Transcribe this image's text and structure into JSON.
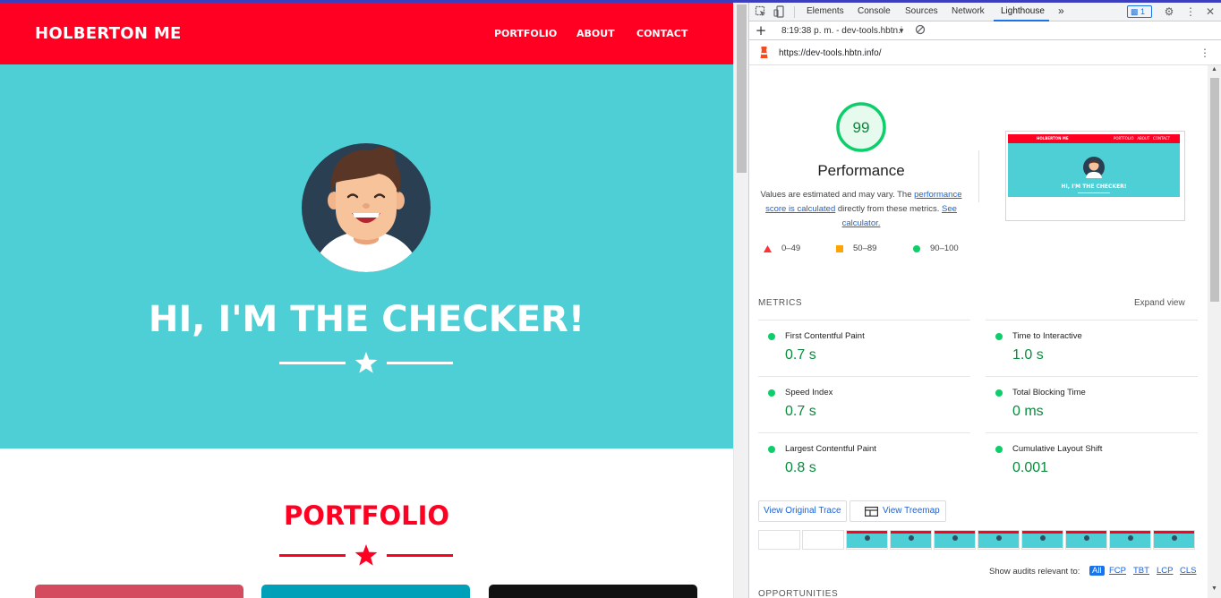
{
  "site": {
    "brand": "HOLBERTON ME",
    "nav": [
      "PORTFOLIO",
      "ABOUT",
      "CONTACT"
    ],
    "hero_title": "HI, I'M THE CHECKER!",
    "portfolio_title": "PORTFOLIO",
    "colors": {
      "red": "#ff0022",
      "teal": "#4ecfd6",
      "card1": "#d44a5e",
      "card2": "#00a0b8",
      "card3": "#111111"
    }
  },
  "devtools": {
    "tabs": [
      "Elements",
      "Console",
      "Sources",
      "Network",
      "Lighthouse"
    ],
    "active_tab": "Lighthouse",
    "more_tabs": "»",
    "issues_count": "1",
    "report": "8:19:38 p. m. - dev-tools.hbtn.i",
    "url": "https://dev-tools.hbtn.info/",
    "score": "99",
    "category": "Performance",
    "note_pre": "Values are estimated and may vary. The ",
    "note_link1": "performance score is calculated",
    "note_mid": " directly from these metrics. ",
    "note_link2": "See calculator.",
    "legend": [
      "0–49",
      "50–89",
      "90–100"
    ],
    "thumb": {
      "brand": "HOLBERTON ME",
      "nav": "PORTFOLIO   ABOUT   CONTACT",
      "hero": "HI, I'M THE CHECKER!"
    },
    "metrics_title": "METRICS",
    "expand_view": "Expand view",
    "metrics": [
      {
        "label": "First Contentful Paint",
        "value": "0.7 s"
      },
      {
        "label": "Time to Interactive",
        "value": "1.0 s"
      },
      {
        "label": "Speed Index",
        "value": "0.7 s"
      },
      {
        "label": "Total Blocking Time",
        "value": "0 ms"
      },
      {
        "label": "Largest Contentful Paint",
        "value": "0.8 s"
      },
      {
        "label": "Cumulative Layout Shift",
        "value": "0.001"
      }
    ],
    "view_trace": "View Original Trace",
    "view_treemap": "View Treemap",
    "show_audits": "Show audits relevant to:",
    "filters": [
      "All",
      "FCP",
      "TBT",
      "LCP",
      "CLS"
    ],
    "opportunities": "OPPORTUNITIES"
  }
}
